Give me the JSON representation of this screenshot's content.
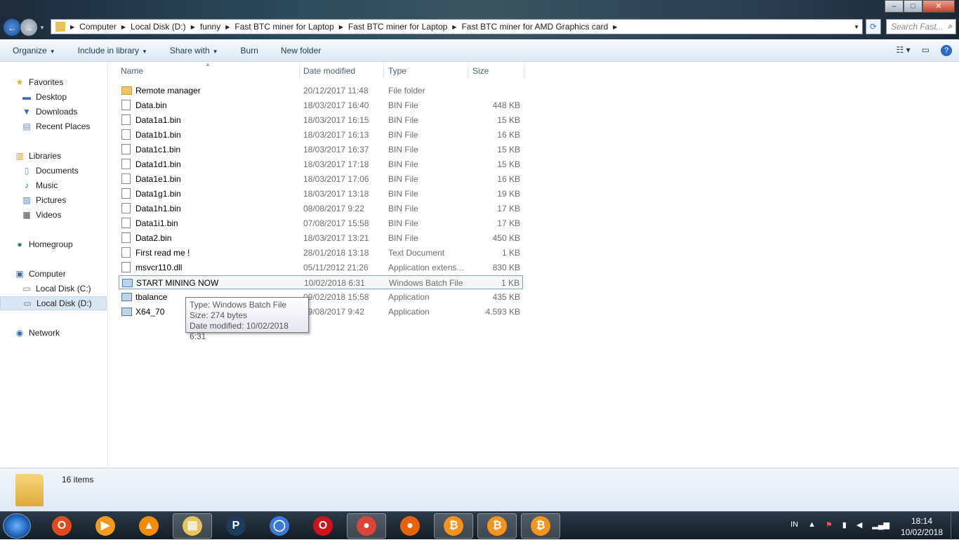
{
  "window": {
    "minimize": "–",
    "maximize": "□",
    "close": "✕"
  },
  "address": {
    "crumbs": [
      "Computer",
      "Local Disk (D:)",
      "funny",
      "Fast BTC miner for Laptop",
      "Fast BTC miner for Laptop",
      "Fast BTC miner for AMD Graphics card"
    ]
  },
  "search": {
    "placeholder": "Search Fast..."
  },
  "toolbar": {
    "organize": "Organize",
    "include": "Include in library",
    "share": "Share with",
    "burn": "Burn",
    "new_folder": "New folder"
  },
  "sidebar": {
    "items": [
      {
        "label": "Favorites",
        "icon": "star-icon"
      },
      {
        "label": "Desktop",
        "icon": "desktop-icon"
      },
      {
        "label": "Downloads",
        "icon": "downloads-icon"
      },
      {
        "label": "Recent Places",
        "icon": "recent-places-icon"
      },
      {
        "label": "Libraries",
        "icon": "libraries-icon"
      },
      {
        "label": "Documents",
        "icon": "documents-icon"
      },
      {
        "label": "Music",
        "icon": "music-icon"
      },
      {
        "label": "Pictures",
        "icon": "pictures-icon"
      },
      {
        "label": "Videos",
        "icon": "videos-icon"
      },
      {
        "label": "Homegroup",
        "icon": "homegroup-icon"
      },
      {
        "label": "Computer",
        "icon": "computer-icon"
      },
      {
        "label": "Local Disk (C:)",
        "icon": "drive-icon"
      },
      {
        "label": "Local Disk (D:)",
        "icon": "drive-icon",
        "selected": true
      },
      {
        "label": "Network",
        "icon": "network-icon"
      }
    ]
  },
  "columns": {
    "name": "Name",
    "date": "Date modified",
    "type": "Type",
    "size": "Size"
  },
  "files": [
    {
      "name": "Remote manager",
      "date": "20/12/2017 11:48",
      "type": "File folder",
      "size": "",
      "kind": "folder"
    },
    {
      "name": "Data.bin",
      "date": "18/03/2017 16:40",
      "type": "BIN File",
      "size": "448 KB",
      "kind": "file"
    },
    {
      "name": "Data1a1.bin",
      "date": "18/03/2017 16:15",
      "type": "BIN File",
      "size": "15 KB",
      "kind": "file"
    },
    {
      "name": "Data1b1.bin",
      "date": "18/03/2017 16:13",
      "type": "BIN File",
      "size": "16 KB",
      "kind": "file"
    },
    {
      "name": "Data1c1.bin",
      "date": "18/03/2017 16:37",
      "type": "BIN File",
      "size": "15 KB",
      "kind": "file"
    },
    {
      "name": "Data1d1.bin",
      "date": "18/03/2017 17:18",
      "type": "BIN File",
      "size": "15 KB",
      "kind": "file"
    },
    {
      "name": "Data1e1.bin",
      "date": "18/03/2017 17:06",
      "type": "BIN File",
      "size": "16 KB",
      "kind": "file"
    },
    {
      "name": "Data1g1.bin",
      "date": "18/03/2017 13:18",
      "type": "BIN File",
      "size": "19 KB",
      "kind": "file"
    },
    {
      "name": "Data1h1.bin",
      "date": "08/08/2017 9:22",
      "type": "BIN File",
      "size": "17 KB",
      "kind": "file"
    },
    {
      "name": "Data1i1.bin",
      "date": "07/08/2017 15:58",
      "type": "BIN File",
      "size": "17 KB",
      "kind": "file"
    },
    {
      "name": "Data2.bin",
      "date": "18/03/2017 13:21",
      "type": "BIN File",
      "size": "450 KB",
      "kind": "file"
    },
    {
      "name": "First read me !",
      "date": "28/01/2018 13:18",
      "type": "Text Document",
      "size": "1 KB",
      "kind": "file"
    },
    {
      "name": "msvcr110.dll",
      "date": "05/11/2012 21:26",
      "type": "Application extens...",
      "size": "830 KB",
      "kind": "file"
    },
    {
      "name": "START MINING NOW",
      "date": "10/02/2018 6:31",
      "type": "Windows Batch File",
      "size": "1 KB",
      "kind": "app",
      "selected": true
    },
    {
      "name": "tbalance",
      "date": "09/02/2018 15:58",
      "type": "Application",
      "size": "435 KB",
      "kind": "app"
    },
    {
      "name": "X64_70",
      "date": "09/08/2017 9:42",
      "type": "Application",
      "size": "4.593 KB",
      "kind": "app"
    }
  ],
  "tooltip": {
    "type": "Type: Windows Batch File",
    "size": "Size: 274 bytes",
    "date": "Date modified: 10/02/2018 6:31"
  },
  "status": {
    "count": "16 items"
  },
  "taskbar": {
    "apps": [
      {
        "icon": "office-icon",
        "color": "#e04a1c",
        "glyph": "O"
      },
      {
        "icon": "media-player-icon",
        "color": "#f39a1e",
        "glyph": "▶"
      },
      {
        "icon": "vlc-icon",
        "color": "#f28c00",
        "glyph": "▲"
      },
      {
        "icon": "file-explorer-icon",
        "color": "#e7c45a",
        "glyph": "▤",
        "active": true
      },
      {
        "icon": "puffin-icon",
        "color": "#1d3b5c",
        "glyph": "P"
      },
      {
        "icon": "chromium-icon",
        "color": "#3a79d8",
        "glyph": "◯"
      },
      {
        "icon": "opera-icon",
        "color": "#d0121b",
        "glyph": "O"
      },
      {
        "icon": "chrome-icon",
        "color": "#db4437",
        "glyph": "●",
        "active": true
      },
      {
        "icon": "firefox-icon",
        "color": "#e8620d",
        "glyph": "●"
      },
      {
        "icon": "bitcoin-icon",
        "color": "#f7931a",
        "glyph": "₿",
        "active": true
      },
      {
        "icon": "bitcoin-icon",
        "color": "#f7931a",
        "glyph": "₿",
        "active": true
      },
      {
        "icon": "bitcoin-icon",
        "color": "#f7931a",
        "glyph": "₿",
        "active": true
      }
    ],
    "language": "IN",
    "time": "18:14",
    "date": "10/02/2018"
  }
}
